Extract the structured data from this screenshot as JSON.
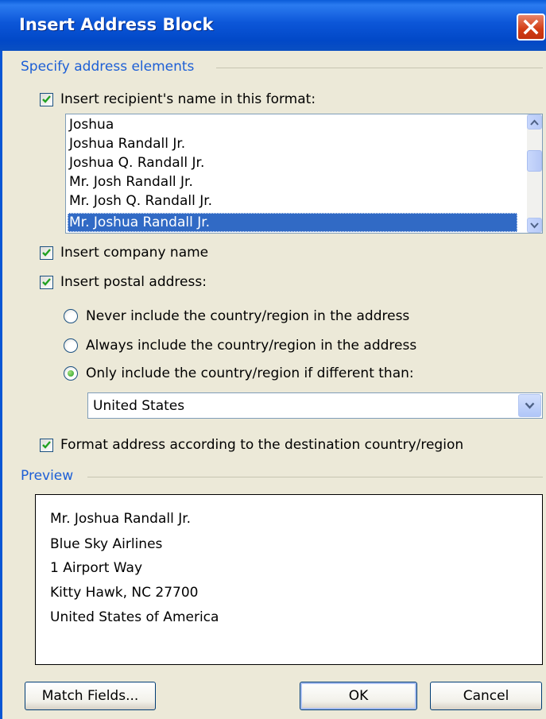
{
  "dialog": {
    "title": "Insert Address Block"
  },
  "address_elements": {
    "section_label": "Specify address elements",
    "recipient_name": {
      "label": "Insert recipient's name in this format:",
      "checked": true,
      "formats": [
        "Joshua",
        "Joshua Randall Jr.",
        "Joshua Q. Randall Jr.",
        "Mr. Josh Randall Jr.",
        "Mr. Josh Q. Randall Jr.",
        "Mr. Joshua Randall Jr."
      ],
      "selected": "Mr. Joshua Randall Jr."
    },
    "company_name": {
      "label": "Insert company name",
      "checked": true
    },
    "postal_address": {
      "label": "Insert postal address:",
      "checked": true,
      "options": [
        "Never include the country/region in the address",
        "Always include the country/region in the address",
        "Only include the country/region if different than:"
      ],
      "selected_option": "Only include the country/region if different than:",
      "country": "United States"
    },
    "format_by_destination": {
      "label": "Format address according to the destination country/region",
      "checked": true
    }
  },
  "preview": {
    "section_label": "Preview",
    "lines": [
      "Mr. Joshua Randall Jr.",
      "Blue Sky Airlines",
      "1 Airport Way",
      "Kitty Hawk, NC 27700",
      "United States of America"
    ]
  },
  "buttons": {
    "match_fields": "Match Fields...",
    "ok": "OK",
    "cancel": "Cancel"
  },
  "colors": {
    "titlebar": "#0a5bd9",
    "section_label": "#1d5fd6",
    "selection": "#316ac5",
    "checkmark": "#21a121"
  },
  "icons": {
    "close": "close-icon",
    "check": "checkmark-icon",
    "scroll_up": "chevron-up-icon",
    "scroll_down": "chevron-down-icon",
    "dropdown": "chevron-down-icon"
  }
}
